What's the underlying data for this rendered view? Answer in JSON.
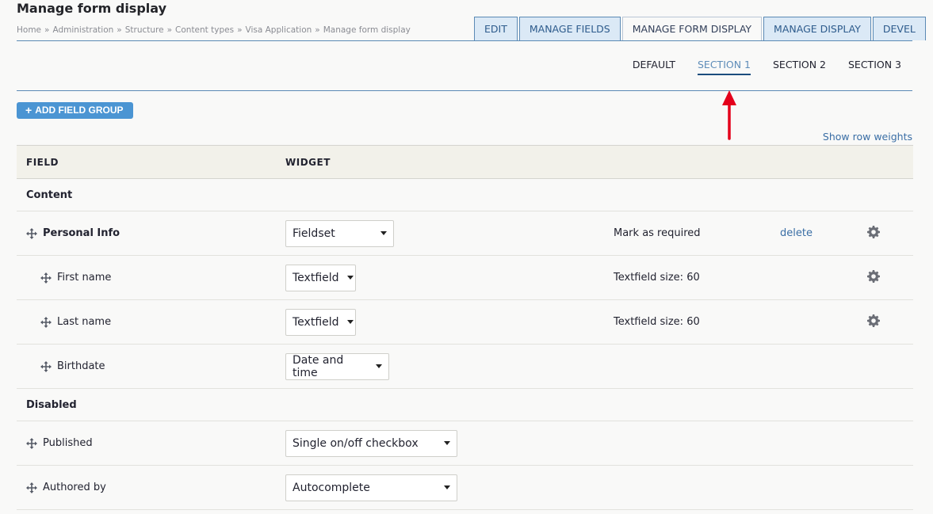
{
  "page": {
    "title": "Manage form display"
  },
  "breadcrumb": [
    "Home",
    "Administration",
    "Structure",
    "Content types",
    "Visa Application",
    "Manage form display"
  ],
  "breadcrumb_sep": "»",
  "primary_tabs": [
    "EDIT",
    "MANAGE FIELDS",
    "MANAGE FORM DISPLAY",
    "MANAGE DISPLAY",
    "DEVEL"
  ],
  "primary_active": "MANAGE FORM DISPLAY",
  "secondary_tabs": [
    "DEFAULT",
    "SECTION 1",
    "SECTION 2",
    "SECTION 3"
  ],
  "secondary_active": "SECTION 1",
  "add_group_label": "ADD FIELD GROUP",
  "add_group_icon": "+",
  "row_weights_label": "Show row weights",
  "table": {
    "headers": [
      "FIELD",
      "WIDGET"
    ],
    "regions": [
      {
        "label": "Content",
        "rows": [
          {
            "name": "Personal Info",
            "bold": true,
            "indent": false,
            "widget": "Fieldset",
            "summary": "Mark as required",
            "delete": "delete",
            "gear": true
          },
          {
            "name": "First name",
            "bold": false,
            "indent": true,
            "widget": "Textfield",
            "summary": "Textfield size: 60",
            "delete": "",
            "gear": true
          },
          {
            "name": "Last name",
            "bold": false,
            "indent": true,
            "widget": "Textfield",
            "summary": "Textfield size: 60",
            "delete": "",
            "gear": true
          },
          {
            "name": "Birthdate",
            "bold": false,
            "indent": true,
            "widget": "Date and time",
            "summary": "",
            "delete": "",
            "gear": false
          }
        ]
      },
      {
        "label": "Disabled",
        "rows": [
          {
            "name": "Published",
            "bold": false,
            "indent": false,
            "widget": "Single on/off checkbox",
            "summary": "",
            "delete": "",
            "gear": false
          },
          {
            "name": "Authored by",
            "bold": false,
            "indent": false,
            "widget": "Autocomplete",
            "summary": "",
            "delete": "",
            "gear": false
          }
        ]
      }
    ]
  },
  "colors": {
    "accent": "#4b95d3",
    "link": "#3a6ea5",
    "arrow": "#e4001b"
  },
  "icons": {
    "drag": "drag-handle-icon",
    "gear": "gear-icon",
    "arrow": "red-arrow-annotation"
  }
}
